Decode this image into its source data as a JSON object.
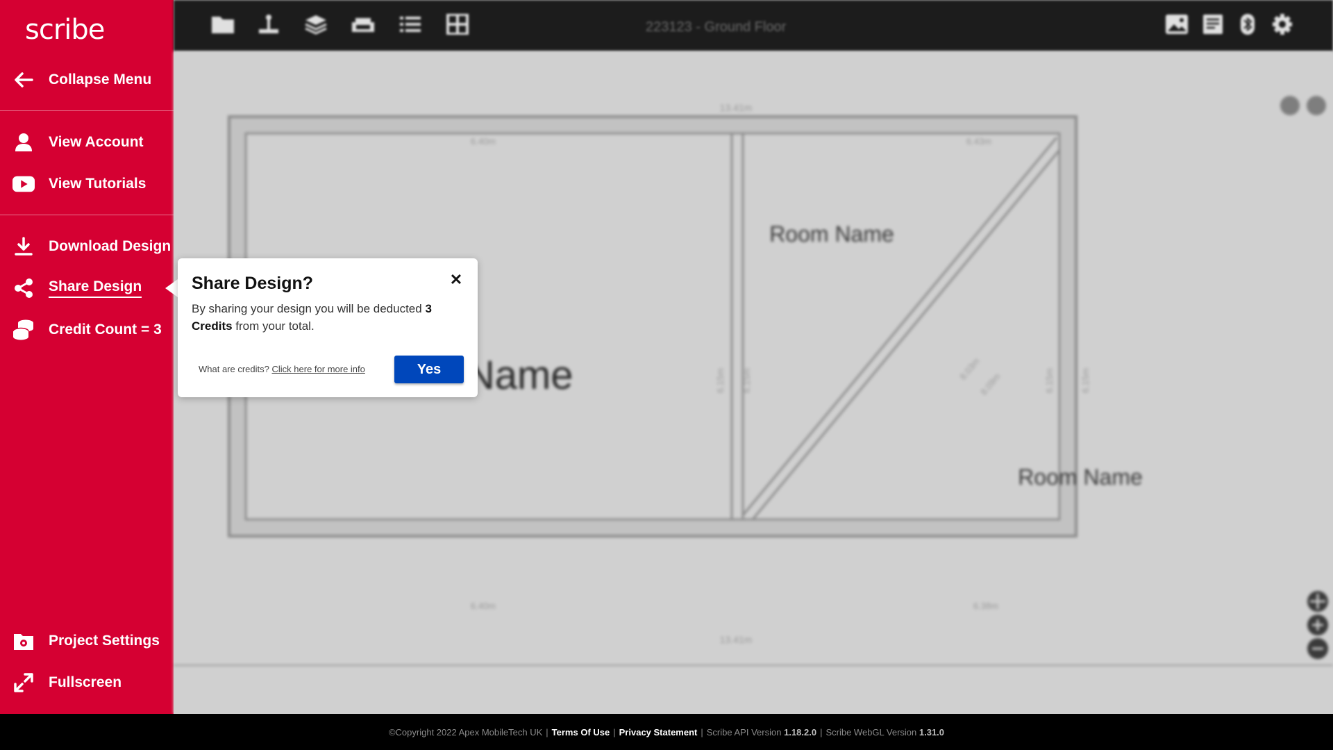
{
  "app": {
    "logo": "scribe"
  },
  "sidebar": {
    "collapse": {
      "label": "Collapse Menu",
      "icon": "arrow-left-icon"
    },
    "items": [
      {
        "label": "View Account",
        "icon": "user-icon"
      },
      {
        "label": "View Tutorials",
        "icon": "youtube-icon"
      },
      {
        "label": "Download Design",
        "icon": "download-icon"
      },
      {
        "label": "Share Design",
        "icon": "share-icon",
        "active": true
      },
      {
        "label": "Credit Count = 3",
        "icon": "coins-icon"
      },
      {
        "label": "Project Settings",
        "icon": "folder-gear-icon"
      },
      {
        "label": "Fullscreen",
        "icon": "expand-icon"
      }
    ]
  },
  "toolbar": {
    "title": "223123 - Ground Floor",
    "left_icons": [
      "folder-icon",
      "anchor-icon",
      "layers-icon",
      "sofa-icon",
      "list-icon",
      "grid-icon"
    ],
    "right_icons": [
      "image-icon",
      "document-icon",
      "bluetooth-icon",
      "gear-icon"
    ]
  },
  "floorplan": {
    "room_labels": [
      {
        "text": "Room Name"
      },
      {
        "text": "Room Name"
      },
      {
        "text": "Room Name"
      }
    ],
    "dimensions": [
      "13.41m",
      "13.41m",
      "6.40m",
      "6.40m",
      "6.43m",
      "6.38m",
      "6.15m",
      "6.15m",
      "6.15m",
      "6.15m",
      "8.03m",
      "8.09m"
    ]
  },
  "popup": {
    "title": "Share Design?",
    "body_prefix": "By sharing your design you will be deducted ",
    "credits_text": "3 Credits",
    "body_suffix": " from your total.",
    "info_prefix": "What are credits?",
    "info_link": "Click here for more info",
    "yes_label": "Yes",
    "close_icon": "close-icon"
  },
  "footer": {
    "copyright": "©Copyright 2022 Apex MobileTech UK",
    "terms": "Terms Of Use",
    "privacy": "Privacy Statement",
    "api_label": "Scribe API Version",
    "api_version": "1.18.2.0",
    "webgl_label": "Scribe WebGL Version",
    "webgl_version": "1.31.0",
    "separator": "|"
  },
  "colors": {
    "brand": "#d50032",
    "button": "#0047bb",
    "toolbar": "#1c1c1c",
    "canvas": "#d0d0d0"
  }
}
